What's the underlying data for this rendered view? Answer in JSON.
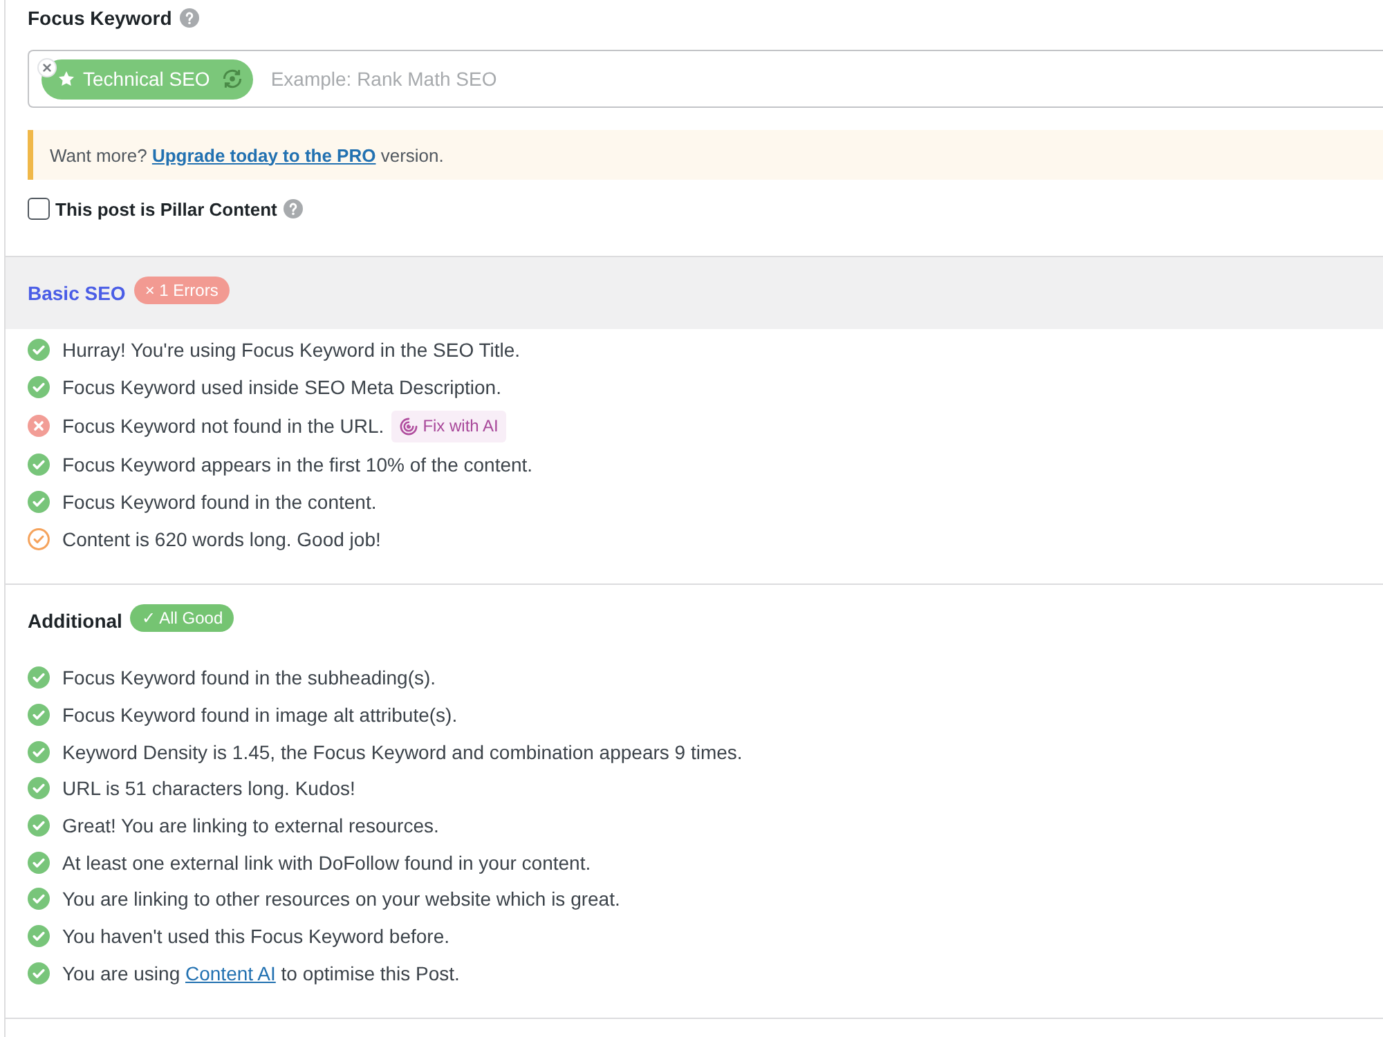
{
  "focus_keyword": {
    "label": "Focus Keyword",
    "keywords": [
      {
        "text": "Technical SEO",
        "primary": true
      }
    ],
    "placeholder": "Example: Rank Math SEO"
  },
  "notice": {
    "text": "Want more? ",
    "link": "Upgrade today to the PRO",
    "text_after": " version."
  },
  "pillar_content": {
    "label": "This post is Pillar Content",
    "checked": false
  },
  "sections": [
    {
      "title": "Basic SEO",
      "selected": true,
      "badge": {
        "kind": "error",
        "text": "× 1 Errors"
      },
      "items": [
        {
          "kind": "pass",
          "text": "Hurray! You're using Focus Keyword in the SEO Title."
        },
        {
          "kind": "pass",
          "text": "Focus Keyword used inside SEO Meta Description."
        },
        {
          "kind": "fail",
          "text": "Focus Keyword not found in the URL.",
          "action": "Fix with AI"
        },
        {
          "kind": "pass",
          "text": "Focus Keyword appears in the first 10% of the content."
        },
        {
          "kind": "pass",
          "text": "Focus Keyword found in the content."
        },
        {
          "kind": "warning",
          "text": "Content is 620 words long. Good job!"
        }
      ]
    },
    {
      "title": "Additional",
      "selected": false,
      "badge": {
        "kind": "success",
        "text": "✓ All Good"
      },
      "items": [
        {
          "kind": "pass",
          "text": "Focus Keyword found in the subheading(s)."
        },
        {
          "kind": "pass",
          "text": "Focus Keyword found in image alt attribute(s)."
        },
        {
          "kind": "pass",
          "text": "Keyword Density is 1.45, the Focus Keyword and combination appears 9 times."
        },
        {
          "kind": "pass",
          "text": "URL is 51 characters long. Kudos!"
        },
        {
          "kind": "pass",
          "text": "Great! You are linking to external resources."
        },
        {
          "kind": "pass",
          "text": "At least one external link with DoFollow found in your content."
        },
        {
          "kind": "pass",
          "text": "You are linking to other resources on your website which is great."
        },
        {
          "kind": "pass",
          "text": "You haven't used this Focus Keyword before."
        },
        {
          "kind": "pass",
          "text": "You are using ",
          "link": "Content AI",
          "text_after": " to optimise this Post."
        }
      ]
    }
  ]
}
